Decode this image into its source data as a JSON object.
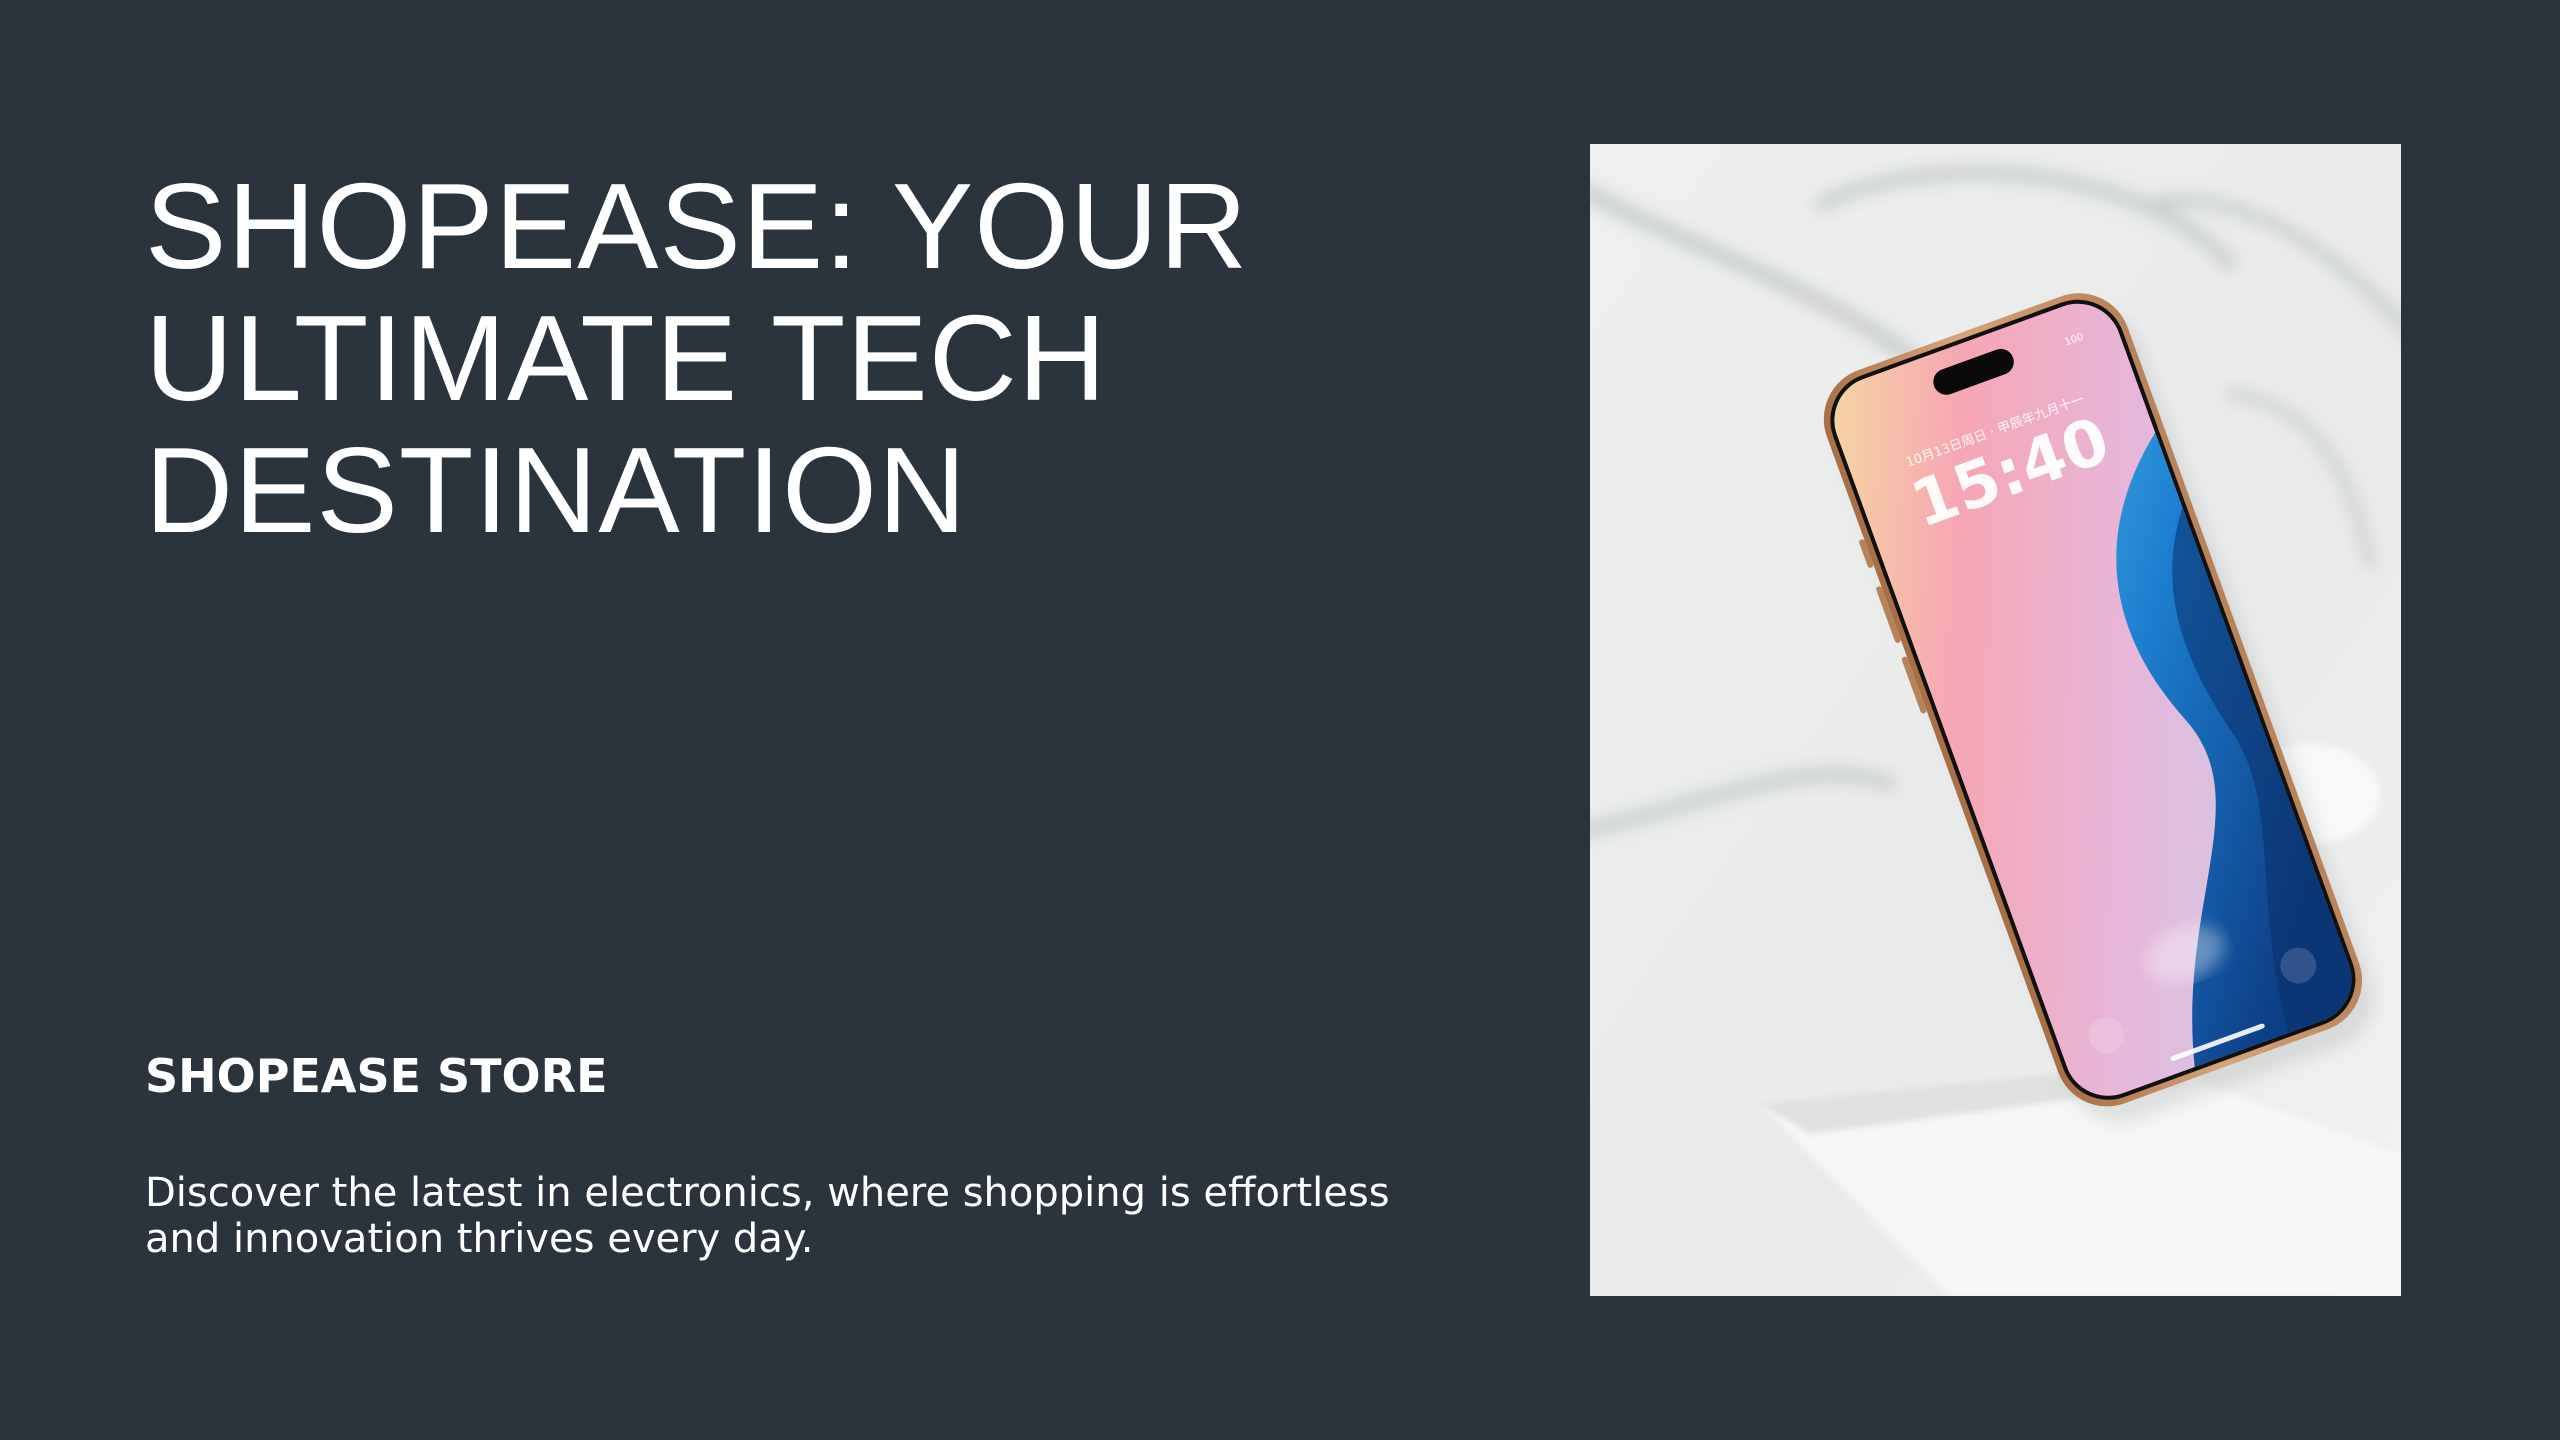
{
  "hero": {
    "headline_lines": [
      "SHOPEASE: YOUR",
      "ULTIMATE TECH",
      "DESTINATION"
    ],
    "store_name": "SHOPEASE STORE",
    "tagline_lines": [
      "Discover the latest in electronics, where shopping is effortless",
      "and innovation thrives every day."
    ]
  },
  "product_photo": {
    "lockscreen_date": "10月13日周日 · 甲辰年九月十一",
    "lockscreen_time": "15:40",
    "battery": "100"
  },
  "colors": {
    "background": "#2b343c",
    "text": "#ffffff",
    "phone_frame": "#c89468"
  }
}
